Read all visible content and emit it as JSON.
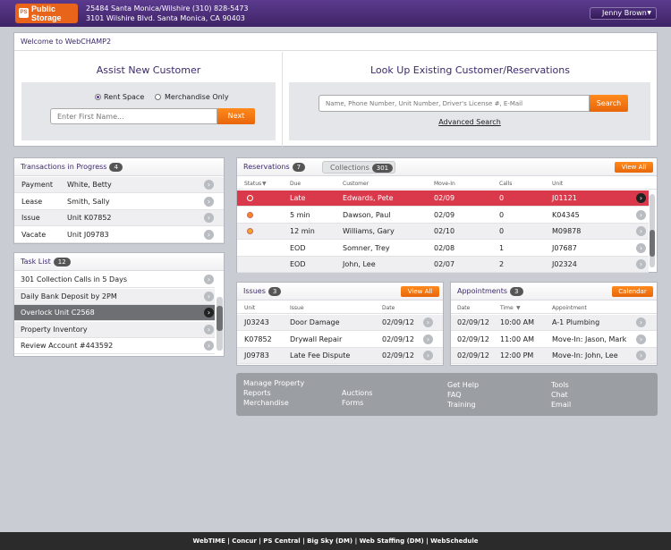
{
  "header": {
    "logo_text": "Public Storage",
    "store_line1": "25484 Santa Monica/Wilshire (310) 828-5473",
    "store_line2": "3101 Wilshire Blvd. Santa Monica, CA 90403",
    "user_name": "Jenny Brown"
  },
  "welcome": {
    "title": "Welcome to WebCHAMP2",
    "assist_title": "Assist New Customer",
    "radio_rent": "Rent Space",
    "radio_merch": "Merchandise Only",
    "radio_selected": "Rent Space",
    "first_name_placeholder": "Enter First Name...",
    "next_label": "Next",
    "lookup_title": "Look Up Existing Customer/Reservations",
    "lookup_placeholder": "Name, Phone Number, Unit Number, Driver's License #, E-Mail",
    "search_label": "Search",
    "advanced_search": "Advanced Search"
  },
  "transactions": {
    "title": "Transactions in Progress",
    "count": "4",
    "rows": [
      {
        "type": "Payment",
        "name": "White, Betty"
      },
      {
        "type": "Lease",
        "name": "Smith, Sally"
      },
      {
        "type": "Issue",
        "name": "Unit K07852"
      },
      {
        "type": "Vacate",
        "name": "Unit J09783"
      }
    ]
  },
  "tasks": {
    "title": "Task List",
    "count": "12",
    "rows": [
      {
        "label": "301 Collection Calls in 5 Days",
        "selected": false
      },
      {
        "label": "Daily Bank Deposit by 2PM",
        "selected": false
      },
      {
        "label": "Overlock Unit C2568",
        "selected": true
      },
      {
        "label": "Property Inventory",
        "selected": false
      },
      {
        "label": "Review Account #443592",
        "selected": false
      }
    ]
  },
  "reservations": {
    "title": "Reservations",
    "count": "7",
    "collections_tab": "Collections",
    "collections_count": "301",
    "view_all": "View All",
    "columns": [
      "Status",
      "Due",
      "Customer",
      "Move-In",
      "Calls",
      "Unit"
    ],
    "rows": [
      {
        "status": "red",
        "due": "Late",
        "customer": "Edwards, Pete",
        "move_in": "02/09",
        "calls": "0",
        "unit": "J01121",
        "highlight": true
      },
      {
        "status": "orange",
        "due": "5 min",
        "customer": "Dawson, Paul",
        "move_in": "02/09",
        "calls": "0",
        "unit": "K04345",
        "highlight": false
      },
      {
        "status": "yellow",
        "due": "12 min",
        "customer": "Williams, Gary",
        "move_in": "02/10",
        "calls": "0",
        "unit": "M09878",
        "highlight": false
      },
      {
        "status": "",
        "due": "EOD",
        "customer": "Somner, Trey",
        "move_in": "02/08",
        "calls": "1",
        "unit": "J07687",
        "highlight": false
      },
      {
        "status": "",
        "due": "EOD",
        "customer": "John, Lee",
        "move_in": "02/07",
        "calls": "2",
        "unit": "J02324",
        "highlight": false
      }
    ]
  },
  "issues": {
    "title": "Issues",
    "count": "3",
    "view_all": "View All",
    "columns": [
      "Unit",
      "Issue",
      "Date"
    ],
    "rows": [
      {
        "unit": "J03243",
        "issue": "Door Damage",
        "date": "02/09/12"
      },
      {
        "unit": "K07852",
        "issue": "Drywall Repair",
        "date": "02/09/12"
      },
      {
        "unit": "J09783",
        "issue": "Late Fee Dispute",
        "date": "02/09/12"
      }
    ]
  },
  "appointments": {
    "title": "Appointments",
    "count": "3",
    "calendar": "Calendar",
    "columns": [
      "Date",
      "Time",
      "Appointment"
    ],
    "rows": [
      {
        "date": "02/09/12",
        "time": "10:00 AM",
        "appt": "A-1 Plumbing"
      },
      {
        "date": "02/09/12",
        "time": "11:00 AM",
        "appt": "Move-In: Jason, Mark"
      },
      {
        "date": "02/09/12",
        "time": "12:00 PM",
        "appt": "Move-In: John, Lee"
      }
    ]
  },
  "links": {
    "manage_property": "Manage Property",
    "reports": "Reports",
    "merchandise": "Merchandise",
    "auctions": "Auctions",
    "forms": "Forms",
    "get_help": "Get Help",
    "faq": "FAQ",
    "training": "Training",
    "tools": "Tools",
    "chat": "Chat",
    "email": "Email"
  },
  "footer": "WebTIME | Concur | PS Central | Big Sky (DM) | Web Staffing (DM) | WebSchedule",
  "colors": {
    "purple": "#4b2d7f",
    "orange": "#f47a14",
    "highlight_red": "#d9394a"
  }
}
